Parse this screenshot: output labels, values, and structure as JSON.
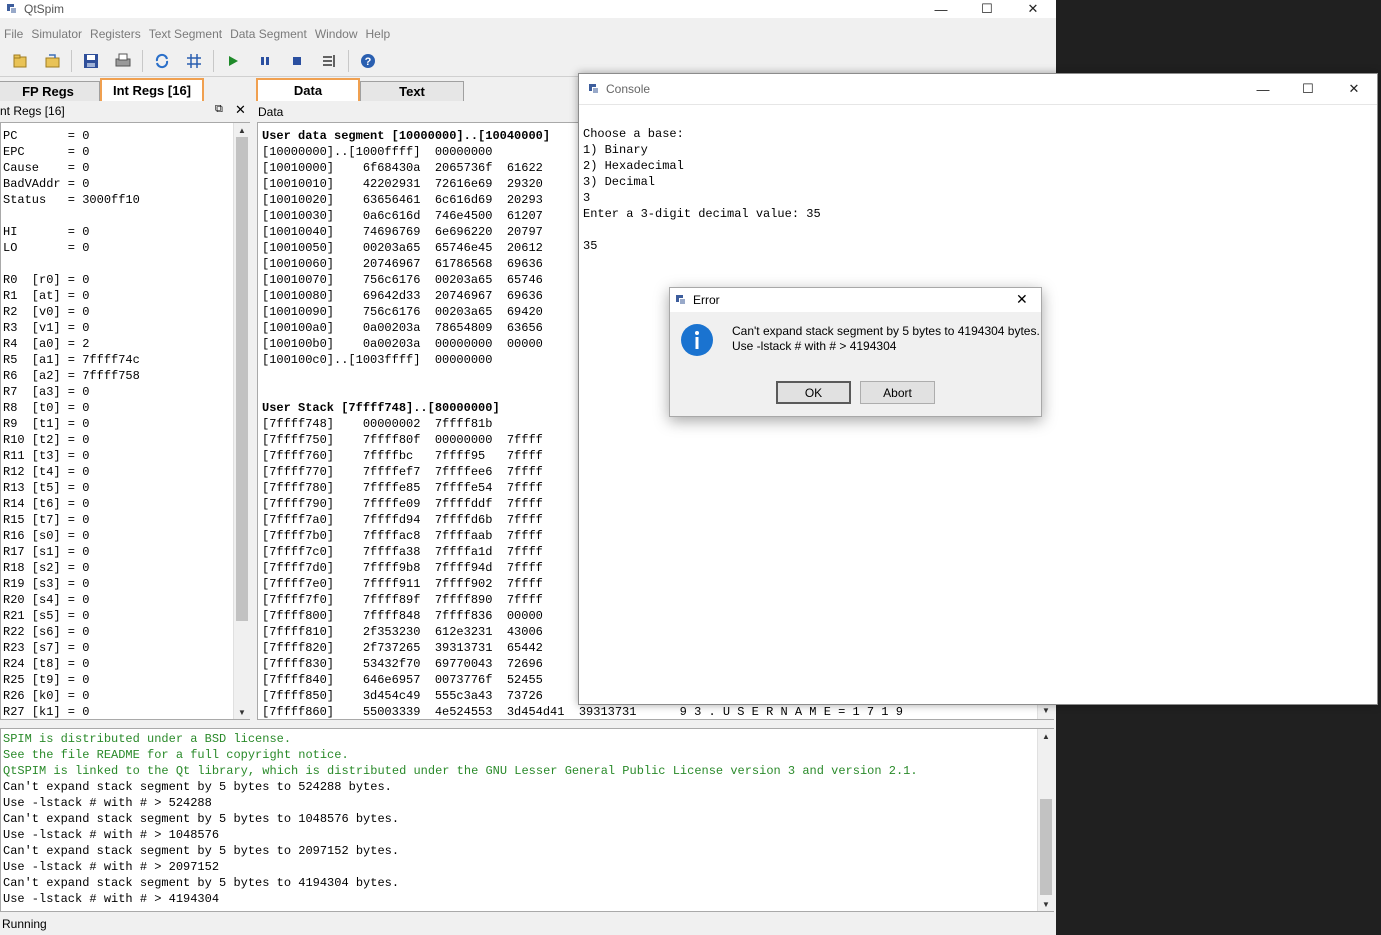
{
  "main_window": {
    "title": "QtSpim"
  },
  "menu": [
    "File",
    "Simulator",
    "Registers",
    "Text Segment",
    "Data Segment",
    "Window",
    "Help"
  ],
  "toolbar_icons": [
    "open-folder-icon",
    "reload-file-icon",
    "save-icon",
    "print-icon",
    "reinitialize-icon",
    "clear-registers-icon",
    "run-icon",
    "pause-icon",
    "stop-icon",
    "single-step-icon",
    "help-icon"
  ],
  "tabs": {
    "fp_regs": "FP Regs",
    "int_regs": "Int Regs [16]",
    "data": "Data",
    "text": "Text"
  },
  "int_regs_panel": {
    "title": "nt Regs [16]",
    "registers": [
      "PC       = 0",
      "EPC      = 0",
      "Cause    = 0",
      "BadVAddr = 0",
      "Status   = 3000ff10",
      "",
      "HI       = 0",
      "LO       = 0",
      "",
      "R0  [r0] = 0",
      "R1  [at] = 0",
      "R2  [v0] = 0",
      "R3  [v1] = 0",
      "R4  [a0] = 2",
      "R5  [a1] = 7ffff74c",
      "R6  [a2] = 7ffff758",
      "R7  [a3] = 0",
      "R8  [t0] = 0",
      "R9  [t1] = 0",
      "R10 [t2] = 0",
      "R11 [t3] = 0",
      "R12 [t4] = 0",
      "R13 [t5] = 0",
      "R14 [t6] = 0",
      "R15 [t7] = 0",
      "R16 [s0] = 0",
      "R17 [s1] = 0",
      "R18 [s2] = 0",
      "R19 [s3] = 0",
      "R20 [s4] = 0",
      "R21 [s5] = 0",
      "R22 [s6] = 0",
      "R23 [s7] = 0",
      "R24 [t8] = 0",
      "R25 [t9] = 0",
      "R26 [k0] = 0",
      "R27 [k1] = 0"
    ]
  },
  "data_panel": {
    "title": "Data",
    "user_data_header": "User data segment [10000000]..[10040000]",
    "user_data_lines": [
      "[10000000]..[1000ffff]  00000000",
      "[10010000]    6f68430a  2065736f  61622",
      "[10010010]    42202931  72616e69  29320",
      "[10010020]    63656461  6c616d69  20293",
      "[10010030]    0a6c616d  746e4500  61207",
      "[10010040]    74696769  6e696220  20797",
      "[10010050]    00203a65  65746e45  20612",
      "[10010060]    20746967  61786568  69636",
      "[10010070]    756c6176  00203a65  65746",
      "[10010080]    69642d33  20746967  69636",
      "[10010090]    756c6176  00203a65  69420",
      "[100100a0]    0a00203a  78654809  63656",
      "[100100b0]    0a00203a  00000000  00000",
      "[100100c0]..[1003ffff]  00000000"
    ],
    "user_stack_header": "User Stack [7ffff748]..[80000000]",
    "user_stack_lines": [
      "[7ffff748]    00000002  7ffff81b",
      "[7ffff750]    7ffff80f  00000000  7ffff",
      "[7ffff760]    7ffffbc   7ffff95   7ffff",
      "[7ffff770]    7ffffef7  7ffffee6  7ffff",
      "[7ffff780]    7ffffe85  7ffffe54  7ffff",
      "[7ffff790]    7ffffe09  7ffffddf  7ffff",
      "[7ffff7a0]    7ffffd94  7ffffd6b  7ffff",
      "[7ffff7b0]    7ffffac8  7ffffaab  7ffff",
      "[7ffff7c0]    7ffffa38  7ffffa1d  7ffff",
      "[7ffff7d0]    7ffff9b8  7ffff94d  7ffff",
      "[7ffff7e0]    7ffff911  7ffff902  7ffff",
      "[7ffff7f0]    7ffff89f  7ffff890  7ffff",
      "[7ffff800]    7ffff848  7ffff836  00000",
      "[7ffff810]    2f353230  612e3231  43006",
      "[7ffff820]    2f737265  39313731  65442",
      "[7ffff830]    53432f70  69770043  72696",
      "[7ffff840]    646e6957  0073776f  52455",
      "[7ffff850]    3d454c49  555c3a43  73726",
      "[7ffff860]    55003339  4e524553  3d454d41  39313731      9 3 . U S E R N A M E = 1 7 1 9"
    ]
  },
  "messages": {
    "green_lines": [
      "SPIM is distributed under a BSD license.",
      "See the file README for a full copyright notice.",
      "QtSPIM is linked to the Qt library, which is distributed under the GNU Lesser General Public License version 3 and version 2.1."
    ],
    "black_lines": [
      "Can't expand stack segment by 5 bytes to 524288 bytes.",
      "Use -lstack # with # > 524288",
      "Can't expand stack segment by 5 bytes to 1048576 bytes.",
      "Use -lstack # with # > 1048576",
      "Can't expand stack segment by 5 bytes to 2097152 bytes.",
      "Use -lstack # with # > 2097152",
      "Can't expand stack segment by 5 bytes to 4194304 bytes.",
      "Use -lstack # with # > 4194304"
    ]
  },
  "status_bar": {
    "text": "Running"
  },
  "console": {
    "title": "Console",
    "lines": [
      "Choose a base:",
      "1) Binary",
      "2) Hexadecimal",
      "3) Decimal",
      "3",
      "Enter a 3-digit decimal value: 35",
      "",
      "35"
    ]
  },
  "error_dialog": {
    "title": "Error",
    "message_line1": "Can't expand stack segment by 5 bytes to 4194304 bytes.",
    "message_line2": "Use -lstack # with # > 4194304",
    "ok_label": "OK",
    "abort_label": "Abort"
  },
  "colors": {
    "green_text": "#2a8a2a",
    "tab_highlight": "#f0a050",
    "info_blue": "#1a73d0"
  }
}
